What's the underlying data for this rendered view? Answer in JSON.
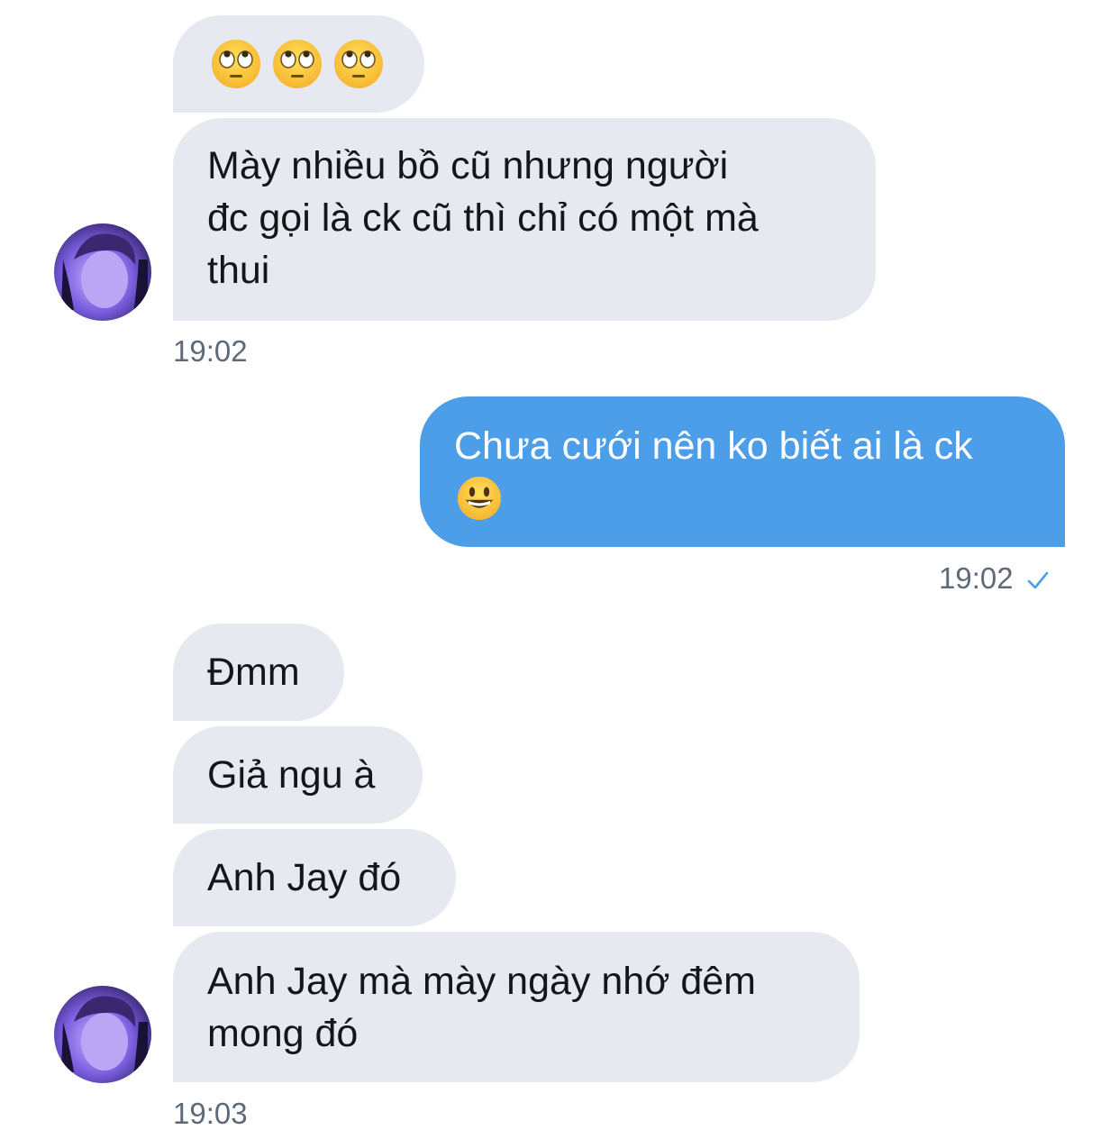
{
  "messages": [
    {
      "emoji": [
        "face-with-rolling-eyes",
        "face-with-rolling-eyes",
        "face-with-rolling-eyes"
      ]
    },
    {
      "text": "Mày nhiều bồ cũ nhưng người\nđc gọi là ck cũ thì chỉ có một mà\nthui"
    },
    {
      "time": "19:02"
    },
    {
      "text": "Chưa cưới nên ko biết ai là ck",
      "emoji": "grinning-face"
    },
    {
      "time": "19:02",
      "status": "checkmark"
    },
    {
      "text": "Đmm"
    },
    {
      "text": "Giả ngu à"
    },
    {
      "text": "Anh Jay đó"
    },
    {
      "text": "Anh Jay mà mày ngày nhớ đêm\nmong đó"
    },
    {
      "time": "19:03"
    }
  ],
  "colors": {
    "incoming_bubble": "#e6e9ef",
    "outgoing_bubble": "#4c9ee8",
    "timestamp": "#5e6a77",
    "check": "#4c9ee8"
  }
}
